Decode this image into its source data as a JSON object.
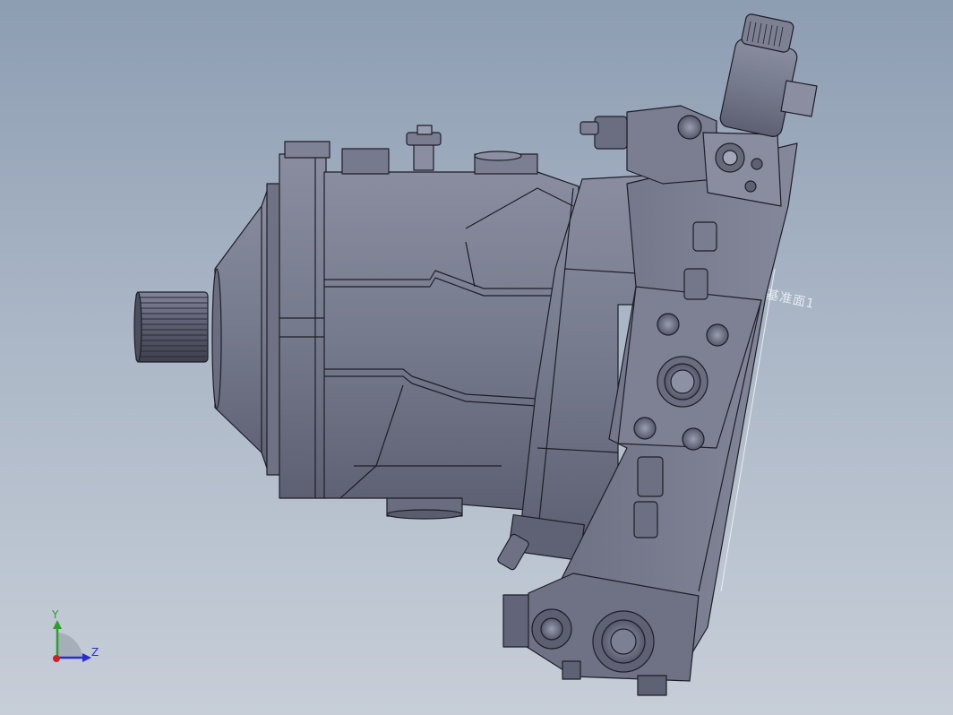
{
  "viewport": {
    "background_top": "#8d9db2",
    "background_bottom": "#c7ced8"
  },
  "model": {
    "body_color": "#727587",
    "edge_color": "#1d1e27"
  },
  "plane_label": "基准面1",
  "triad": {
    "y_label": "Y",
    "z_label": "Z",
    "y_color": "#2aa02a",
    "z_color": "#2b2bd0",
    "x_color": "#d02020"
  }
}
